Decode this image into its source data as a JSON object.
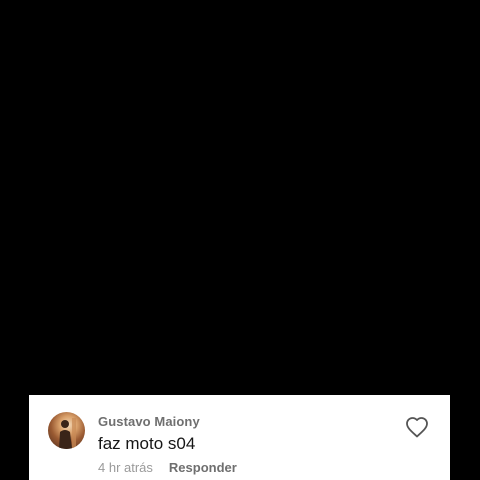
{
  "comment": {
    "author": "Gustavo Maiony",
    "text": "faz moto s04",
    "timestamp": "4 hr atrás",
    "reply_label": "Responder",
    "like_icon": "heart-outline-icon"
  },
  "colors": {
    "background": "#000000",
    "card": "#ffffff",
    "author": "#6f6f6f",
    "text": "#161616",
    "timestamp": "#9a9a9a"
  }
}
